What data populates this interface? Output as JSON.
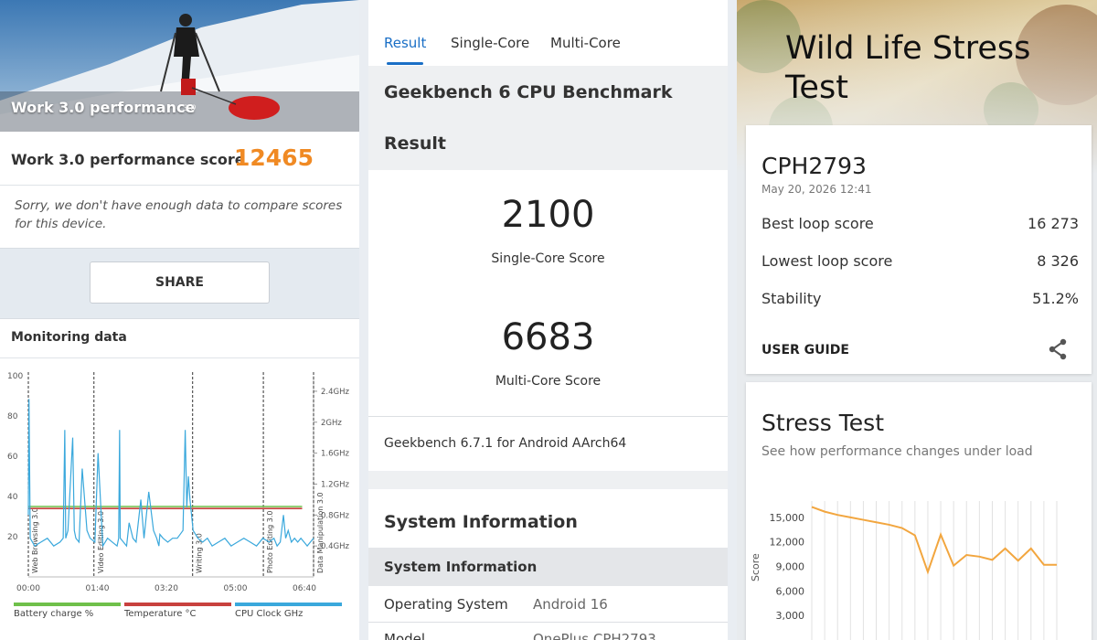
{
  "left": {
    "hero_title": "Work 3.0 performance",
    "hero_badge": "3.0",
    "score_label": "Work 3.0 performance score",
    "score_value": "12465",
    "note": "Sorry, we don't have enough data to compare scores for this device.",
    "share_label": "SHARE",
    "monitoring_title": "Monitoring data",
    "chart_data": {
      "type": "line",
      "x_ticks": [
        "00:00",
        "01:40",
        "03:20",
        "05:00",
        "06:40"
      ],
      "y_ticks_left": [
        "100",
        "80",
        "60",
        "40",
        "20"
      ],
      "y_ticks_right": [
        "2.4GHz",
        "2GHz",
        "1.6GHz",
        "1.2GHz",
        "0.8GHz",
        "0.4GHz"
      ],
      "ylim_left": [
        0,
        100
      ],
      "ylim_right": [
        0,
        2.6
      ],
      "section_labels": [
        "Web Browsing 3.0",
        "Video Editing 3.0",
        "Writing 3.0",
        "Photo Editing 3.0",
        "Data Manipulation 3.0"
      ],
      "section_starts": [
        0,
        115,
        288,
        412,
        500
      ],
      "x_max_seconds": 500,
      "legend": [
        "Battery charge %",
        "Temperature °C",
        "CPU Clock GHz"
      ],
      "series": [
        {
          "name": "Battery charge %",
          "color": "#6fc04a",
          "x": [
            0,
            480
          ],
          "y": [
            35,
            35
          ]
        },
        {
          "name": "Temperature °C",
          "color": "#c8413e",
          "x": [
            0,
            480
          ],
          "y": [
            34,
            34
          ]
        },
        {
          "name": "CPU Clock GHz",
          "color": "#3aa8dc",
          "x": [
            0,
            2,
            6,
            20,
            40,
            60,
            80,
            100,
            110,
            115,
            118,
            125,
            140,
            145,
            150,
            160,
            170,
            185,
            195,
            210,
            220,
            235,
            250,
            265,
            280,
            285,
            288,
            290,
            300,
            310,
            318,
            330,
            340,
            355,
            365,
            380,
            395,
            405,
            412,
            415,
            425,
            440,
            455,
            470,
            488,
            495,
            500,
            505,
            510,
            520,
            535,
            550,
            565,
            580,
            600,
            620,
            640,
            660,
            680,
            700,
            720,
            740,
            760,
            775,
            785,
            795,
            805,
            812,
            820,
            830,
            840,
            850,
            860,
            870,
            880,
            890,
            900
          ],
          "y": [
            0.8,
            2.3,
            0.5,
            0.4,
            0.45,
            0.5,
            0.4,
            0.45,
            0.5,
            1.9,
            0.5,
            0.6,
            1.8,
            0.6,
            0.5,
            0.45,
            1.4,
            0.6,
            0.5,
            0.45,
            1.6,
            0.4,
            0.5,
            0.45,
            0.4,
            0.5,
            1.9,
            0.5,
            0.45,
            0.4,
            0.7,
            0.5,
            0.45,
            1.0,
            0.5,
            1.1,
            0.6,
            0.5,
            0.4,
            0.55,
            0.5,
            0.45,
            0.5,
            0.5,
            0.6,
            1.9,
            0.9,
            1.3,
            1.0,
            0.6,
            0.5,
            0.45,
            0.5,
            0.4,
            0.45,
            0.5,
            0.4,
            0.45,
            0.5,
            0.45,
            0.4,
            0.5,
            0.45,
            0.5,
            0.4,
            0.45,
            0.8,
            0.5,
            0.6,
            0.45,
            0.5,
            0.45,
            0.5,
            0.45,
            0.4,
            0.45,
            0.5
          ]
        }
      ]
    }
  },
  "mid": {
    "tabs": [
      "Result",
      "Single-Core",
      "Multi-Core"
    ],
    "active_tab": 0,
    "bench_title": "Geekbench 6 CPU Benchmark",
    "result_title": "Result",
    "single_score": "2100",
    "single_label": "Single-Core Score",
    "multi_score": "6683",
    "multi_label": "Multi-Core Score",
    "version": "Geekbench 6.7.1 for Android AArch64",
    "sys_head": "System Information",
    "sys_bar": "System Information",
    "rows": [
      {
        "k": "Operating System",
        "v": "Android 16"
      },
      {
        "k": "Model",
        "v": "OnePlus CPH2793"
      }
    ]
  },
  "right": {
    "hero_title": "Wild Life Stress Test",
    "device": "CPH2793",
    "date": "May 20, 2026 12:41",
    "rows": [
      {
        "k": "Best loop score",
        "v": "16 273"
      },
      {
        "k": "Lowest loop score",
        "v": "8 326"
      },
      {
        "k": "Stability",
        "v": "51.2%"
      }
    ],
    "guide": "USER GUIDE",
    "stress_title": "Stress Test",
    "stress_sub": "See how performance changes under load",
    "chart_data": {
      "type": "line",
      "ylabel": "Score",
      "y_ticks": [
        "15,000",
        "12,000",
        "9,000",
        "6,000",
        "3,000"
      ],
      "ylim": [
        0,
        17000
      ],
      "color": "#f2a63f",
      "x": [
        1,
        2,
        3,
        4,
        5,
        6,
        7,
        8,
        9,
        10,
        11,
        12,
        13,
        14,
        15,
        16,
        17,
        18,
        19,
        20
      ],
      "y": [
        16273,
        15700,
        15300,
        15000,
        14700,
        14400,
        14100,
        13700,
        12800,
        8326,
        12900,
        9100,
        10400,
        10200,
        9800,
        11200,
        9700,
        11200,
        9200,
        9200
      ]
    }
  }
}
